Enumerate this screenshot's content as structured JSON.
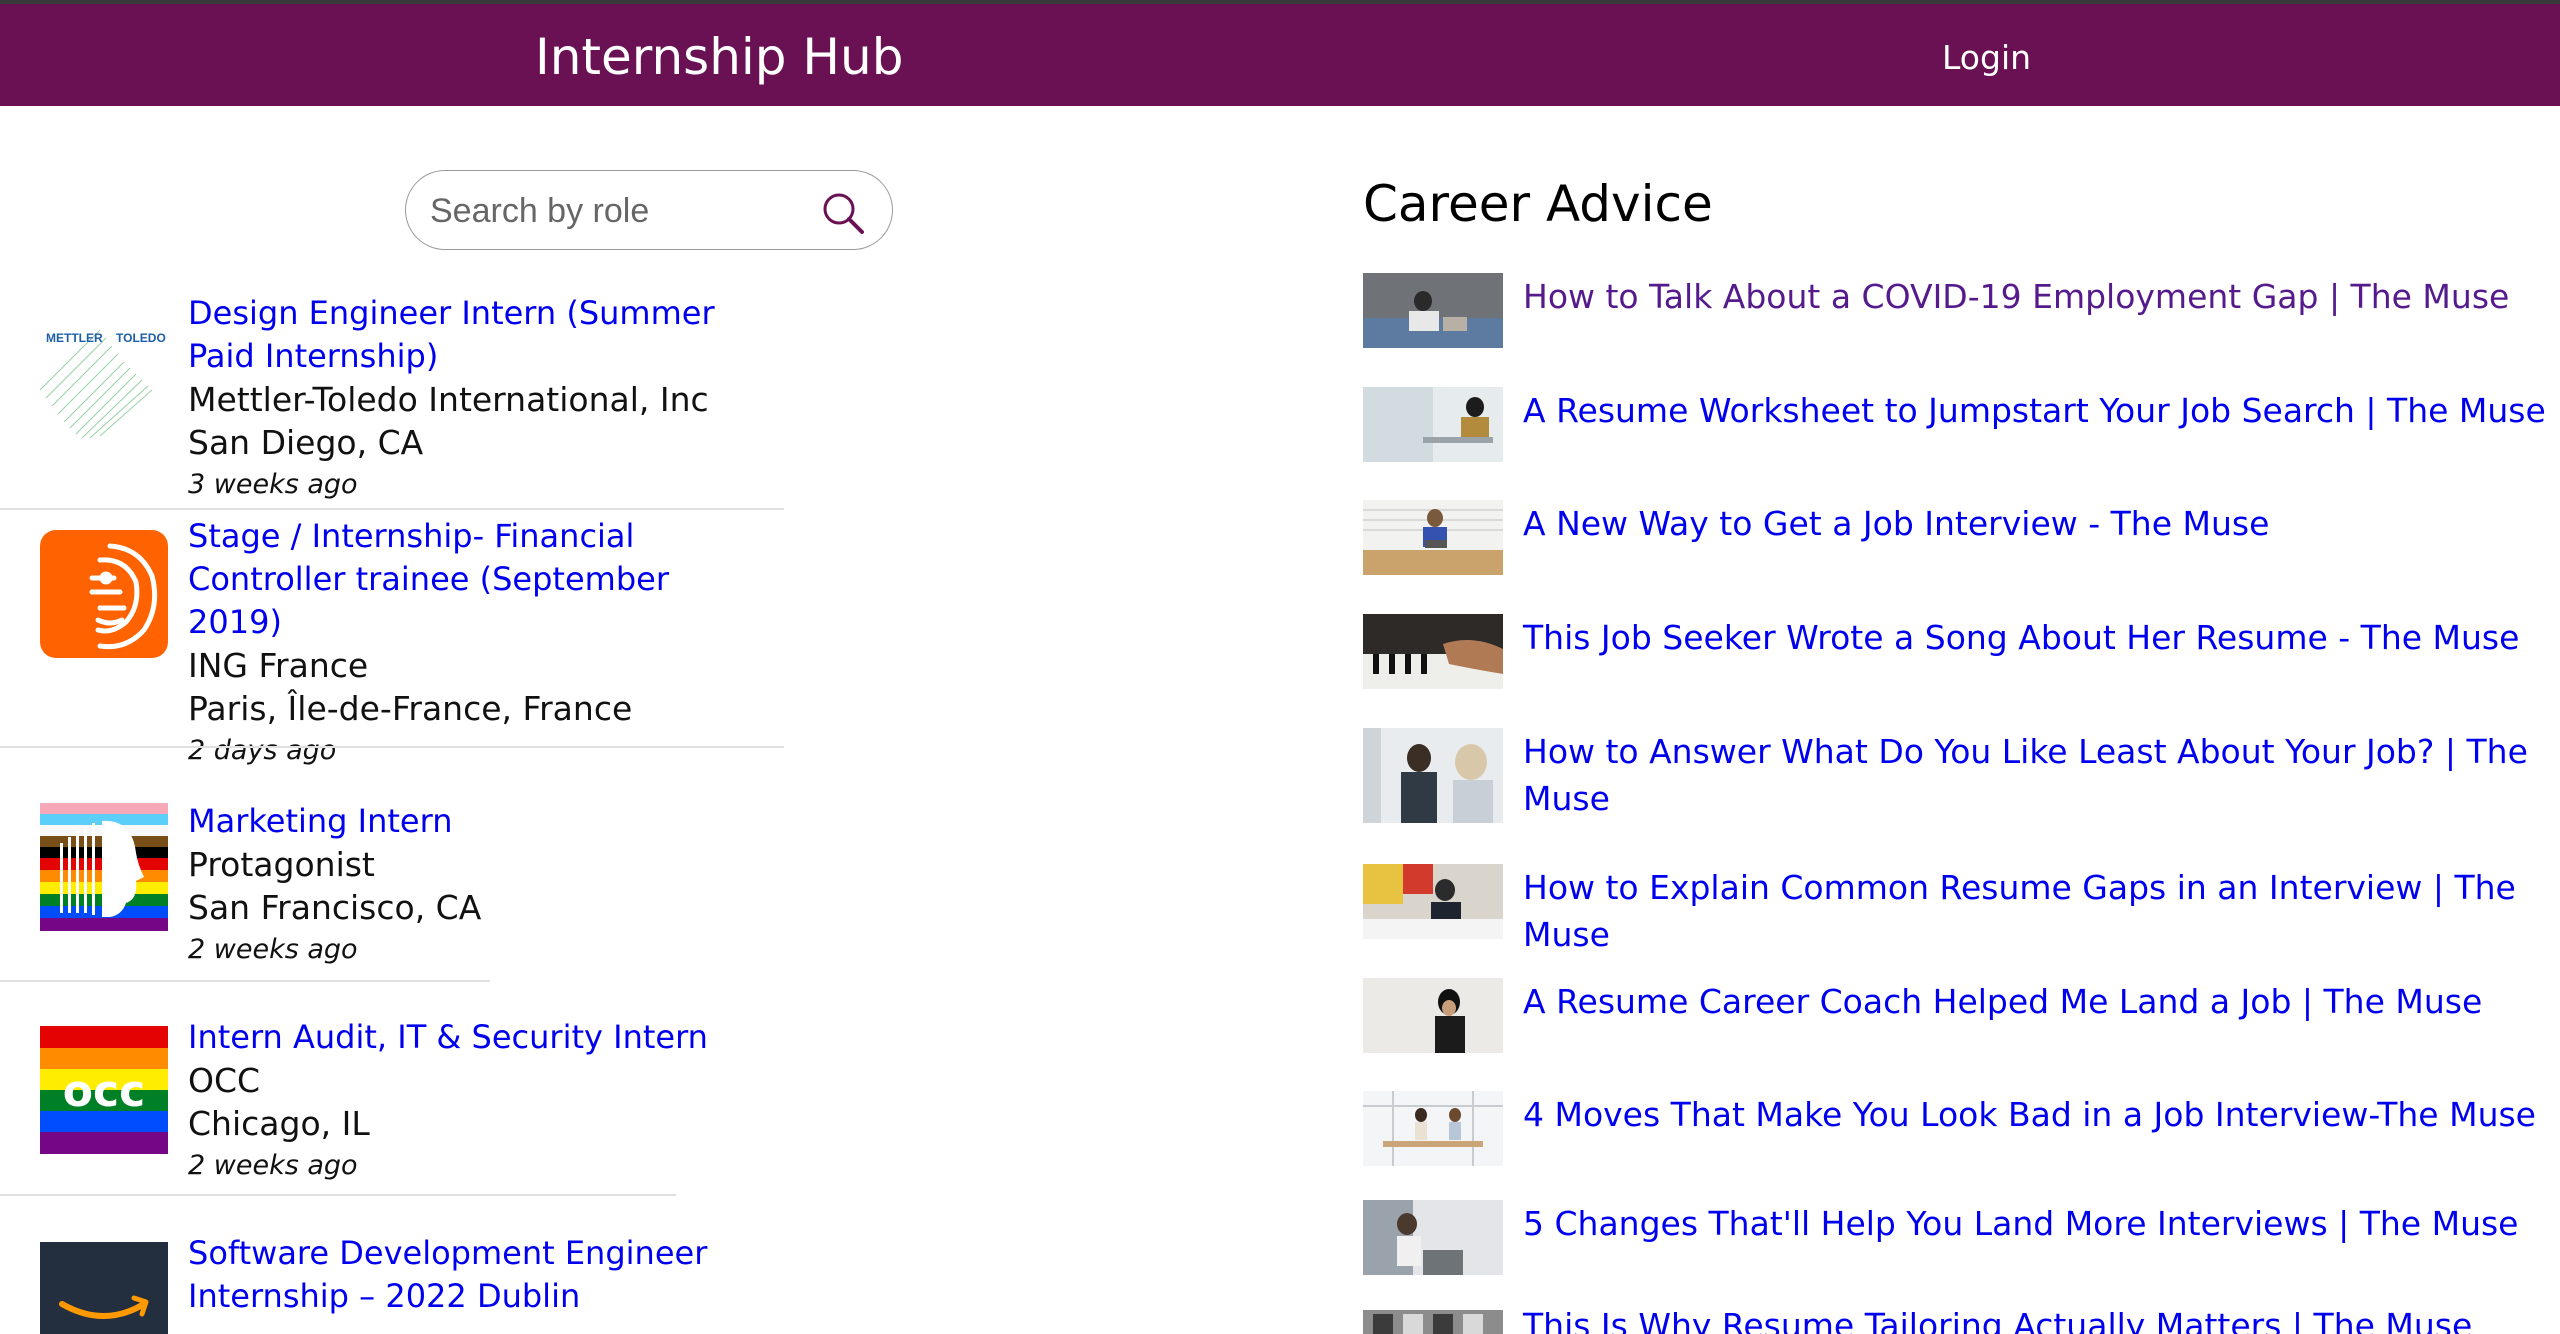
{
  "header": {
    "brand": "Internship Hub",
    "login_label": "Login"
  },
  "search": {
    "placeholder": "Search by role",
    "value": ""
  },
  "jobs": [
    {
      "title": "Design Engineer Intern (Summer Paid Internship)",
      "company": "Mettler-Toledo International, Inc",
      "location": "San Diego, CA",
      "posted": "3 weeks ago",
      "logo": "mettler-toledo-logo",
      "logo_text": [
        "METTLER",
        "TOLEDO"
      ]
    },
    {
      "title": "Stage / Internship- Financial Controller trainee (September 2019)",
      "company": "ING France",
      "location": "Paris, Île-de-France, France",
      "posted": "2 days ago",
      "logo": "ing-lion-logo"
    },
    {
      "title": "Marketing Intern",
      "company": "Protagonist",
      "location": "San Francisco, CA",
      "posted": "2 weeks ago",
      "logo": "protagonist-pride-logo"
    },
    {
      "title": "Intern Audit, IT & Security Intern",
      "company": "OCC",
      "location": "Chicago, IL",
      "posted": "2 weeks ago",
      "logo": "occ-pride-logo",
      "logo_text": "occ"
    },
    {
      "title": "Software Development Engineer Internship – 2022 Dublin",
      "logo": "amazon-logo"
    }
  ],
  "career_advice": {
    "heading": "Career Advice",
    "articles": [
      {
        "title": "How to Talk About a COVID-19 Employment Gap | The Muse",
        "visited": true
      },
      {
        "title": "A Resume Worksheet to Jumpstart Your Job Search | The Muse"
      },
      {
        "title": "A New Way to Get a Job Interview - The Muse"
      },
      {
        "title": "This Job Seeker Wrote a Song About Her Resume - The Muse"
      },
      {
        "title": "How to Answer What Do You Like Least About Your Job? | The Muse"
      },
      {
        "title": "How to Explain Common Resume Gaps in an Interview | The Muse"
      },
      {
        "title": "A Resume Career Coach Helped Me Land a Job | The Muse"
      },
      {
        "title": "4 Moves That Make You Look Bad in a Job Interview-The Muse"
      },
      {
        "title": "5 Changes That'll Help You Land More Interviews | The Muse"
      },
      {
        "title": "This Is Why Resume Tailoring Actually Matters | The Muse"
      }
    ]
  },
  "colors": {
    "header_bg": "#691152",
    "link": "#0000ee",
    "visited_link": "#551a8b"
  }
}
